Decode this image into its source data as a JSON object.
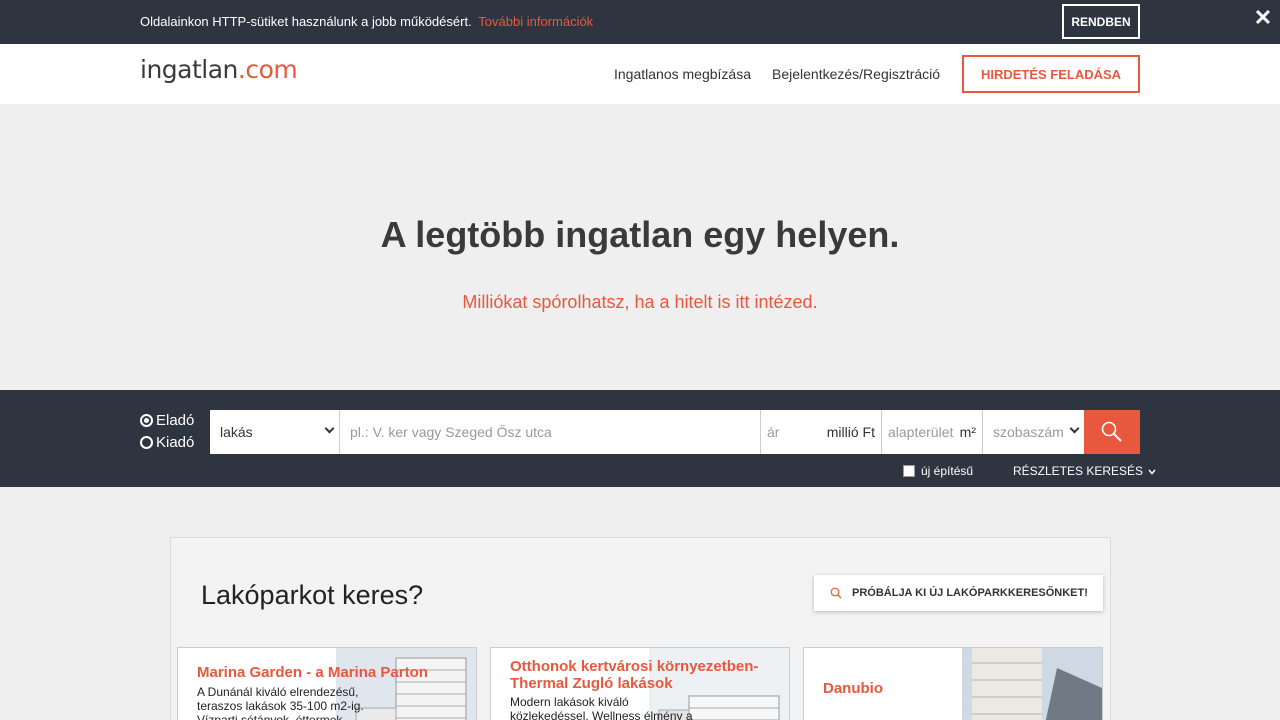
{
  "cookie": {
    "text": "Oldalainkon HTTP-sütiket használunk a jobb működésért.",
    "link": "További információk",
    "ok_label": "RENDBEN",
    "close_symbol": "✕"
  },
  "header": {
    "logo_main": "ingatlan",
    "logo_tld": ".com",
    "nav": [
      "Ingatlanos megbízása",
      "Bejelentkezés/Regisztráció"
    ],
    "post_ad_label": "HIRDETÉS FELADÁSA"
  },
  "hero": {
    "title": "A legtöbb ingatlan egy helyen.",
    "subtitle": "Milliókat spórolhatsz, ha a hitelt is itt intézed."
  },
  "search": {
    "modes": [
      {
        "label": "Eladó",
        "selected": true
      },
      {
        "label": "Kiadó",
        "selected": false
      }
    ],
    "type_value": "lakás",
    "location_placeholder": "pl.: V. ker vagy Szeged Ősz utca",
    "price_placeholder": "ár",
    "price_unit": "millió Ft",
    "area_placeholder": "alapterület",
    "area_unit": "m²",
    "rooms_placeholder": "szobaszám",
    "new_build_label": "új építésű",
    "advanced_label": "RÉSZLETES KERESÉS"
  },
  "lakopark": {
    "title": "Lakóparkot keres?",
    "button_label": "PRÓBÁLJA KI ÚJ LAKÓPARKKERESŐNKET!",
    "cards": [
      {
        "title": "Marina Garden - a Marina Parton",
        "desc": "A Dunánál kiváló elrendezésű, teraszos lakások 35-100 m2-ig. Vízparti sétányok, éttermek"
      },
      {
        "title": "Otthonok kertvárosi környezetben- Thermal Zugló lakások",
        "desc": "Modern lakások kiváló közlekedéssel. Wellness élmény a"
      },
      {
        "title": "Danubio",
        "desc": ""
      }
    ]
  },
  "colors": {
    "accent": "#e8583e",
    "dark": "#2f3441"
  }
}
